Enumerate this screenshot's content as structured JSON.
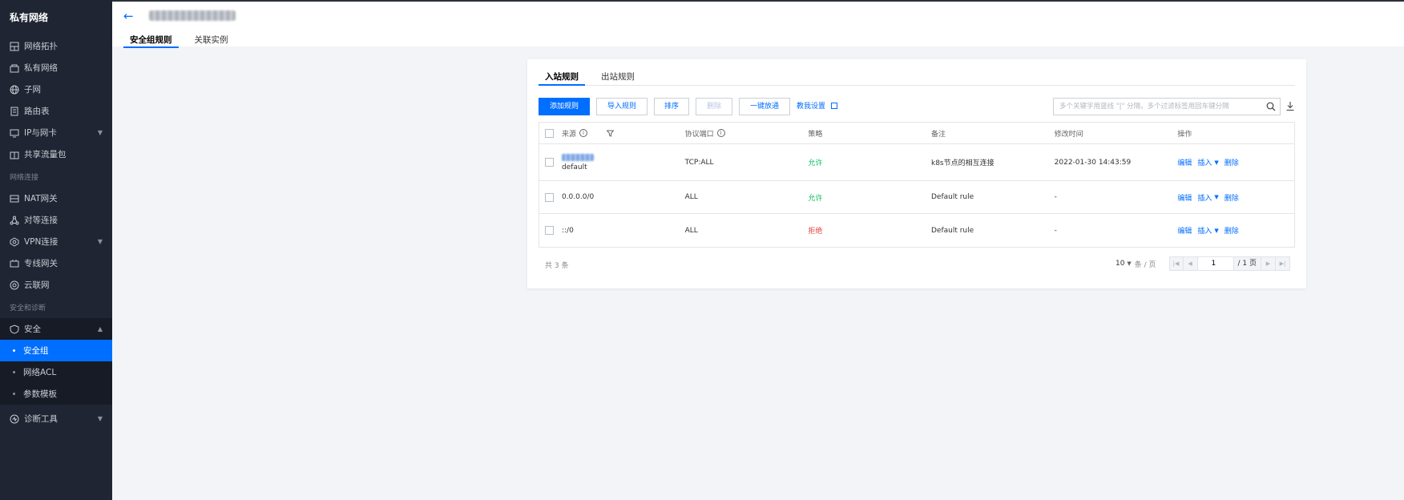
{
  "sidebar": {
    "title": "私有网络",
    "items": [
      {
        "label": "网络拓扑",
        "icon": "topology-icon"
      },
      {
        "label": "私有网络",
        "icon": "vpc-icon"
      },
      {
        "label": "子网",
        "icon": "subnet-icon"
      },
      {
        "label": "路由表",
        "icon": "route-table-icon"
      },
      {
        "label": "IP与网卡",
        "icon": "nic-icon"
      },
      {
        "label": "共享流量包",
        "icon": "traffic-package-icon"
      }
    ],
    "section_network": "网络连接",
    "network_items": [
      {
        "label": "NAT网关",
        "icon": "nat-gateway-icon"
      },
      {
        "label": "对等连接",
        "icon": "peering-icon"
      },
      {
        "label": "VPN连接",
        "icon": "vpn-icon"
      },
      {
        "label": "专线网关",
        "icon": "direct-gateway-icon"
      },
      {
        "label": "云联网",
        "icon": "ccn-icon"
      }
    ],
    "section_security": "安全和诊断",
    "security": {
      "label": "安全",
      "icon": "shield-icon"
    },
    "security_sub": [
      {
        "label": "安全组",
        "active": true
      },
      {
        "label": "网络ACL",
        "active": false
      },
      {
        "label": "参数模板",
        "active": false
      }
    ],
    "diagnostics": {
      "label": "诊断工具",
      "icon": "diagnostic-icon"
    }
  },
  "header": {
    "tabs": [
      "安全组规则",
      "关联实例"
    ]
  },
  "rules": {
    "tabs": [
      "入站规则",
      "出站规则"
    ],
    "toolbar": {
      "add": "添加规则",
      "import": "导入规则",
      "sort": "排序",
      "delete": "删除",
      "allow_all": "一键放通",
      "tutorial": "教我设置"
    },
    "search_placeholder": "多个关键字用竖线 \"|\" 分隔，多个过滤标签用回车键分隔",
    "columns": [
      "来源",
      "协议端口",
      "策略",
      "备注",
      "修改时间",
      "操作"
    ],
    "rows": [
      {
        "source": "default",
        "protocol": "TCP:ALL",
        "policy": "允许",
        "policy_type": "allow",
        "note": "k8s节点的相互连接",
        "time": "2022-01-30 14:43:59"
      },
      {
        "source": "0.0.0.0/0",
        "protocol": "ALL",
        "policy": "允许",
        "policy_type": "allow",
        "note": "Default rule",
        "time": "-"
      },
      {
        "source": "::/0",
        "protocol": "ALL",
        "policy": "拒绝",
        "policy_type": "deny",
        "note": "Default rule",
        "time": "-"
      }
    ],
    "ops": {
      "edit": "编辑",
      "insert": "插入",
      "delete": "删除"
    },
    "footer": {
      "total": "共 3 条",
      "page_size": "10",
      "page_unit": "条 / 页",
      "page": "1",
      "page_total": "/ 1 页"
    }
  }
}
